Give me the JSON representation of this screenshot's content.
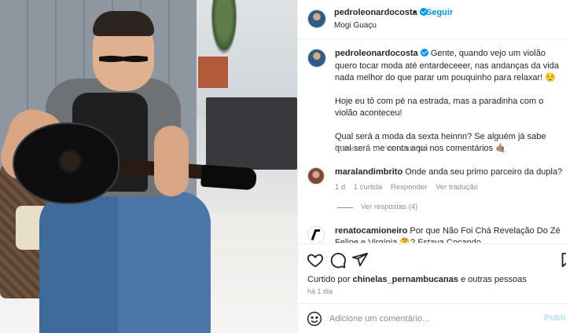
{
  "post_header": {
    "username": "pedroleonardocosta",
    "separator": "•",
    "follow_label": "Seguir",
    "location": "Mogi Guaçu"
  },
  "caption": {
    "username": "pedroleonardocosta",
    "paragraph_1": "Gente, quando vejo um violão quero tocar moda até entardeceeer, nas andanças da vida nada melhor do que parar um pouquinho para relaxar! 😌",
    "paragraph_2": "Hoje eu tô com pé na estrada, mas a paradinha com o violão aconteceu!",
    "paragraph_3": "Qual será a moda da sexta heinnn? Se alguém já sabe qual será me conta aqui nos comentários 🤙🏽",
    "edited": "Editado · 1 d",
    "see_translation": "Ver tradução"
  },
  "comments": [
    {
      "username": "maralandimbrito",
      "text": "Onde anda seu primo parceiro da dupla?",
      "age": "1 d",
      "likes": "1 curtida",
      "reply": "Responder",
      "see_translation": "Ver tradução",
      "view_replies": "Ver respostas (4)"
    },
    {
      "username": "renatocamioneiro",
      "text": "Por que Não Foi Chá Revelação Do Zé Felipe e Virgínia 🤔? Estava Cocando"
    }
  ],
  "actions": {
    "like_icon": "heart-icon",
    "comment_icon": "comment-icon",
    "share_icon": "share-icon",
    "save_icon": "bookmark-icon"
  },
  "likes": {
    "prefix": "Curtido por",
    "user": "chinelas_pernambucanas",
    "suffix": "e outras pessoas"
  },
  "post_age": "há 1 dia",
  "composer": {
    "placeholder": "Adicione um comentário...",
    "publish_label": "Publicar",
    "emoji_icon": "smiley-icon"
  },
  "colors": {
    "accent": "#0095f6",
    "publish_disabled": "#b2dffc",
    "muted": "#8e8e8e"
  }
}
